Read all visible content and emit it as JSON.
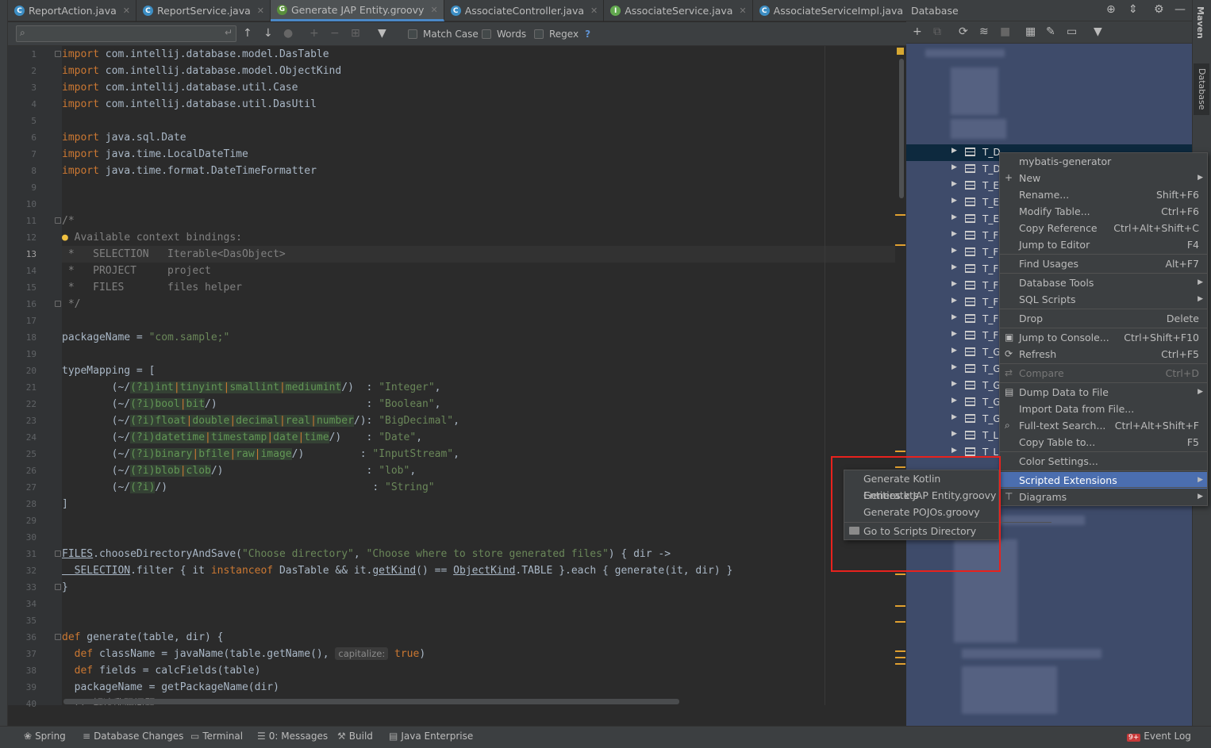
{
  "tabs": [
    {
      "icon": "C",
      "kind": "class",
      "label": "ReportAction.java"
    },
    {
      "icon": "C",
      "kind": "class",
      "label": "ReportService.java"
    },
    {
      "icon": "G",
      "kind": "groovy",
      "label": "Generate JAP Entity.groovy",
      "active": true
    },
    {
      "icon": "C",
      "kind": "class",
      "label": "AssociateController.java"
    },
    {
      "icon": "I",
      "kind": "interface",
      "label": "AssociateService.java"
    },
    {
      "icon": "C",
      "kind": "class",
      "label": "AssociateServiceImpl.java"
    }
  ],
  "search": {
    "match_case": "Match Case",
    "words": "Words",
    "regex": "Regex",
    "help": "?"
  },
  "editor": {
    "current_line": 13,
    "line_numbers": [
      "1",
      "2",
      "3",
      "4",
      "5",
      "6",
      "7",
      "8",
      "9",
      "10",
      "11",
      "12",
      "13",
      "14",
      "15",
      "16",
      "17",
      "18",
      "19",
      "20",
      "21",
      "22",
      "23",
      "24",
      "25",
      "26",
      "27",
      "28",
      "29",
      "30",
      "31",
      "32",
      "33",
      "34",
      "35",
      "36",
      "37",
      "38",
      "39",
      "40"
    ],
    "lines": {
      "l1": [
        "import",
        " com.intellij.database.model.DasTable"
      ],
      "l2": [
        "import",
        " com.intellij.database.model.ObjectKind"
      ],
      "l3": [
        "import",
        " com.intellij.database.util.Case"
      ],
      "l4": [
        "import",
        " com.intellij.database.util.DasUtil"
      ],
      "l6": [
        "import",
        " java.sql.Date"
      ],
      "l7": [
        "import",
        " java.time.LocalDateTime"
      ],
      "l8": [
        "import",
        " java.time.format.DateTimeFormatter"
      ],
      "l11": "/*",
      "l12": " Available context bindings:",
      "l13": " *   SELECTION   Iterable<DasObject>",
      "l14": " *   PROJECT     project",
      "l15": " *   FILES       files helper",
      "l16": " */",
      "l18": [
        "packageName = ",
        "\"com.sample;\""
      ],
      "l20": "typeMapping = [",
      "l21": {
        "pre": "        (~/",
        "flag": "(?i)",
        "alts": [
          "int",
          "tinyint",
          "smallint",
          "mediumint"
        ],
        "post": "/)  : ",
        "type": "\"Integer\"",
        "end": ","
      },
      "l22": {
        "pre": "        (~/",
        "flag": "(?i)",
        "alts": [
          "bool",
          "bit"
        ],
        "post": "/)                        : ",
        "type": "\"Boolean\"",
        "end": ","
      },
      "l23": {
        "pre": "        (~/",
        "flag": "(?i)",
        "alts": [
          "float",
          "double",
          "decimal",
          "real",
          "number"
        ],
        "post": "/): ",
        "type": "\"BigDecimal\"",
        "end": ","
      },
      "l24": {
        "pre": "        (~/",
        "flag": "(?i)",
        "alts": [
          "datetime",
          "timestamp",
          "date",
          "time"
        ],
        "post": "/)    : ",
        "type": "\"Date\"",
        "end": ","
      },
      "l25": {
        "pre": "        (~/",
        "flag": "(?i)",
        "alts": [
          "binary",
          "bfile",
          "raw",
          "image"
        ],
        "post": "/)         : ",
        "type": "\"InputStream\"",
        "end": ","
      },
      "l26": {
        "pre": "        (~/",
        "flag": "(?i)",
        "alts": [
          "blob",
          "clob"
        ],
        "post": "/)                       : ",
        "type": "\"lob\"",
        "end": ","
      },
      "l27": {
        "pre": "        (~/",
        "flag": "(?i)",
        "alts": [],
        "post": "/)                                 : ",
        "type": "\"String\"",
        "end": ""
      },
      "l28": "]",
      "l31": {
        "a": "FILES",
        "b": ".chooseDirectoryAndSave(",
        "c": "\"Choose directory\"",
        "d": ", ",
        "e": "\"Choose where to store generated files\"",
        "f": ") { dir ->"
      },
      "l32": {
        "a": "  SELECTION",
        "b": ".filter { it ",
        "c": "instanceof",
        "d": " DasTable && it.",
        "e": "getKind",
        "f": "() == ",
        "g": "ObjectKind",
        "h": ".TABLE }.each { generate(it, dir) }"
      },
      "l33": "}",
      "l36": [
        "def",
        " generate(table, dir) {"
      ],
      "l37": {
        "a": "  ",
        "b": "def",
        "c": " className = javaName(table.getName(), ",
        "hint": "capitalize:",
        "d": " ",
        "e": "true",
        "f": ")"
      },
      "l38": {
        "a": "  ",
        "b": "def",
        "c": " fields = calcFields(table)"
      },
      "l39": "  packageName = getPackageName(dir)",
      "l40": "  // 解决乱码问题"
    }
  },
  "database_panel": {
    "title": "Database",
    "tree_prefix": "T_",
    "rows": [
      {
        "name": "T_D",
        "selected": true
      },
      {
        "name": "T_D"
      },
      {
        "name": "T_E"
      },
      {
        "name": "T_E"
      },
      {
        "name": "T_E"
      },
      {
        "name": "T_FI"
      },
      {
        "name": "T_F("
      },
      {
        "name": "T_F("
      },
      {
        "name": "T_F("
      },
      {
        "name": "T_F("
      },
      {
        "name": "T_F("
      },
      {
        "name": "T_F("
      },
      {
        "name": "T_G"
      },
      {
        "name": "T_G"
      },
      {
        "name": "T_G"
      },
      {
        "name": "T_G"
      },
      {
        "name": "T_G"
      },
      {
        "name": "T_L"
      },
      {
        "name": "T_L"
      }
    ]
  },
  "context_menu": {
    "items": [
      {
        "label": "mybatis-generator",
        "shortcut": "",
        "submenu": false
      },
      {
        "label": "New",
        "shortcut": "",
        "submenu": true,
        "icon": "plus-icon"
      },
      {
        "label": "Rename...",
        "shortcut": "Shift+F6"
      },
      {
        "label": "Modify Table...",
        "shortcut": "Ctrl+F6"
      },
      {
        "label": "Copy Reference",
        "shortcut": "Ctrl+Alt+Shift+C"
      },
      {
        "label": "Jump to Editor",
        "shortcut": "F4"
      },
      {
        "label": "Find Usages",
        "shortcut": "Alt+F7"
      },
      {
        "label": "Database Tools",
        "shortcut": "",
        "submenu": true
      },
      {
        "label": "SQL Scripts",
        "shortcut": "",
        "submenu": true
      },
      {
        "label": "Drop",
        "shortcut": "Delete"
      },
      {
        "label": "Jump to Console...",
        "shortcut": "Ctrl+Shift+F10",
        "icon": "console-icon"
      },
      {
        "label": "Refresh",
        "shortcut": "Ctrl+F5",
        "icon": "refresh-icon"
      },
      {
        "label": "Compare",
        "shortcut": "Ctrl+D",
        "disabled": true,
        "icon": "compare-icon"
      },
      {
        "label": "Dump Data to File",
        "shortcut": "",
        "submenu": true,
        "icon": "dump-icon"
      },
      {
        "label": "Import Data from File...",
        "shortcut": ""
      },
      {
        "label": "Full-text Search...",
        "shortcut": "Ctrl+Alt+Shift+F",
        "icon": "search-icon"
      },
      {
        "label": "Copy Table to...",
        "shortcut": "F5"
      },
      {
        "label": "Color Settings...",
        "shortcut": ""
      },
      {
        "label": "Scripted Extensions",
        "shortcut": "",
        "submenu": true,
        "highlighted": true
      },
      {
        "label": "Diagrams",
        "shortcut": "",
        "submenu": true,
        "icon": "diagram-icon"
      }
    ]
  },
  "scripted_submenu": {
    "items": [
      {
        "label": "Generate Kotlin Entities.kts"
      },
      {
        "label": "Generate JAP Entity.groovy"
      },
      {
        "label": "Generate POJOs.groovy"
      },
      {
        "label": "Go to Scripts Directory"
      }
    ]
  },
  "right_bar": {
    "maven": "Maven",
    "database": "Database"
  },
  "status_bar": {
    "spring": "Spring",
    "db_changes": "Database Changes",
    "terminal": "Terminal",
    "messages": "0: Messages",
    "build": "Build",
    "java_enterprise": "Java Enterprise",
    "event_log": "Event Log",
    "event_badge": "9+"
  },
  "colors": {
    "accent": "#4b6eaf",
    "annotation": "#e8221d",
    "selection": "#0d293e"
  }
}
